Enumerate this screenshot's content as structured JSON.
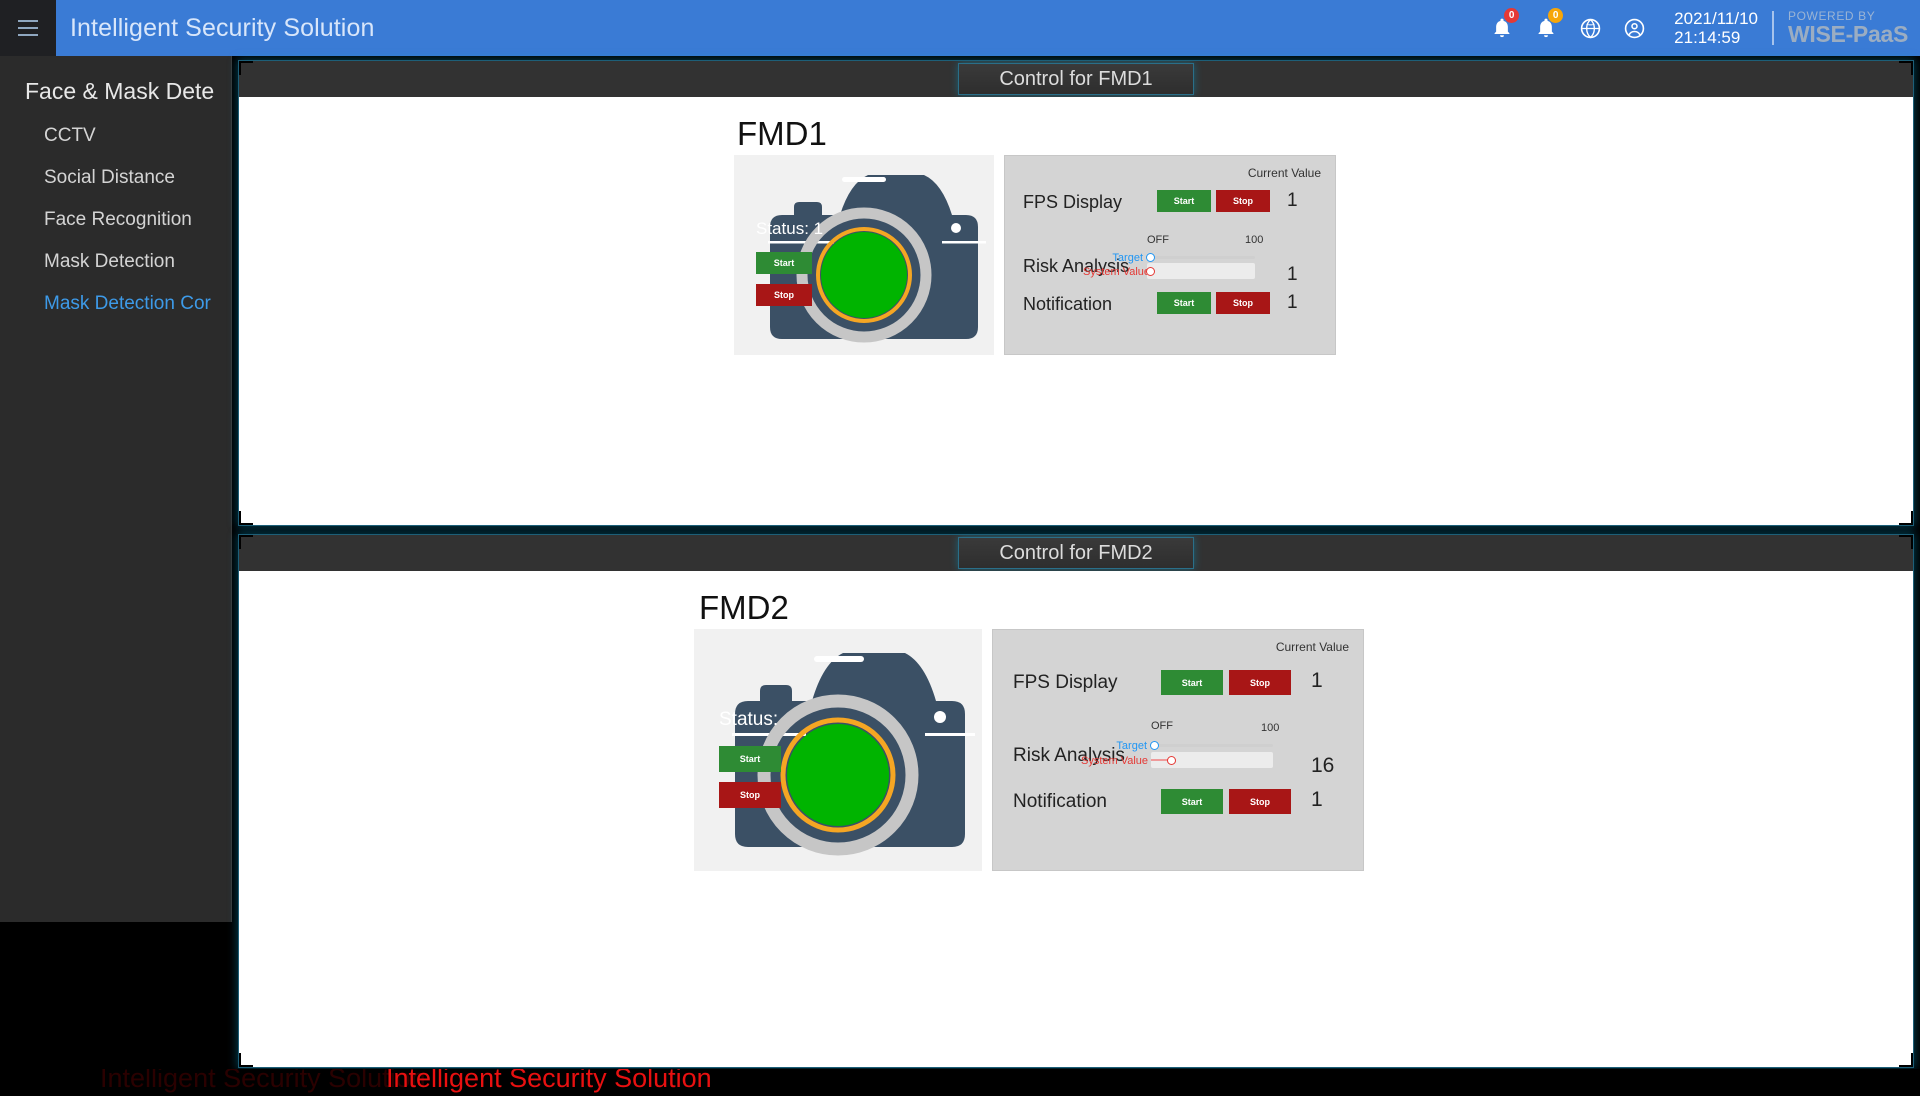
{
  "header": {
    "menu_icon": "hamburger-icon",
    "title": "Intelligent Security Solution",
    "alerts": [
      {
        "icon": "bell-icon",
        "count": "0",
        "color": "#e53935"
      },
      {
        "icon": "bell-icon",
        "count": "0",
        "color": "#f6a609"
      }
    ],
    "globe_icon": "globe-icon",
    "account_icon": "account-circle-icon",
    "date": "2021/11/10",
    "time": "21:14:59",
    "powered_by_label": "POWERED BY",
    "brand": "WISE-PaaS"
  },
  "sidebar": {
    "group_title": "Face & Mask Dete",
    "items": [
      {
        "label": "CCTV",
        "active": false
      },
      {
        "label": "Social Distance",
        "active": false
      },
      {
        "label": "Face Recognition",
        "active": false
      },
      {
        "label": "Mask Detection",
        "active": false
      },
      {
        "label": "Mask Detection Cor",
        "active": true
      }
    ]
  },
  "panels": [
    {
      "title": "Control for FMD1",
      "heading": "FMD1",
      "camera": {
        "status_label": "Status:",
        "status_value": "1",
        "lens_color": "#00b400",
        "ring_color": "#f5a623",
        "body_color": "#3b5065",
        "start_label": "Start",
        "stop_label": "Stop"
      },
      "control": {
        "current_value_label": "Current Value",
        "rows": [
          {
            "name": "FPS Display",
            "type": "buttons",
            "start_label": "Start",
            "stop_label": "Stop",
            "value": "1"
          },
          {
            "name": "Risk Analysis",
            "type": "slider",
            "min_label": "OFF",
            "max_label": "100",
            "target_label": "Target",
            "system_label": "System Value",
            "target_value": 0,
            "system_value": 0,
            "value": "1"
          },
          {
            "name": "Notification",
            "type": "buttons",
            "start_label": "Start",
            "stop_label": "Stop",
            "value": "1"
          }
        ]
      }
    },
    {
      "title": "Control for FMD2",
      "heading": "FMD2",
      "camera": {
        "status_label": "Status:",
        "status_value": "",
        "lens_color": "#00b400",
        "ring_color": "#f5a623",
        "body_color": "#3b5065",
        "start_label": "Start",
        "stop_label": "Stop"
      },
      "control": {
        "current_value_label": "Current Value",
        "rows": [
          {
            "name": "FPS Display",
            "type": "buttons",
            "start_label": "Start",
            "stop_label": "Stop",
            "value": "1"
          },
          {
            "name": "Risk Analysis",
            "type": "slider",
            "min_label": "OFF",
            "max_label": "100",
            "target_label": "Target",
            "system_label": "System Value",
            "target_value": 0,
            "system_value": 16,
            "value": "16"
          },
          {
            "name": "Notification",
            "type": "buttons",
            "start_label": "Start",
            "stop_label": "Stop",
            "value": "1"
          }
        ]
      }
    }
  ],
  "footer": {
    "overlay_text": "Intelligent Security Solution"
  }
}
